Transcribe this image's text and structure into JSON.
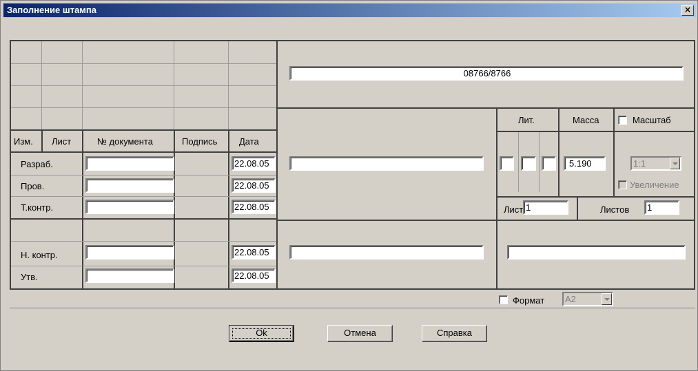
{
  "window": {
    "title": "Заполнение штампа",
    "close_label": "×"
  },
  "table": {
    "headers": {
      "izm": "Изм.",
      "list": "Лист",
      "doc": "№ документа",
      "sign": "Подпись",
      "date": "Дата"
    },
    "rows": {
      "razrab": {
        "label": "Разраб.",
        "doc": "",
        "date": "22.08.05"
      },
      "prov": {
        "label": "Пров.",
        "doc": "",
        "date": "22.08.05"
      },
      "tkontr": {
        "label": "Т.контр.",
        "doc": "",
        "date": "22.08.05"
      },
      "nkontr": {
        "label": "Н. контр.",
        "doc": "",
        "date": "22.08.05"
      },
      "utv": {
        "label": "Утв.",
        "doc": "",
        "date": "22.08.05"
      }
    }
  },
  "right": {
    "designation": "08766/8766",
    "name": "",
    "material": "",
    "organization": "",
    "lit_label": "Лит.",
    "lit": [
      "",
      "",
      ""
    ],
    "massa_label": "Масса",
    "massa": "5.190",
    "masshtab_label": "Масштаб",
    "masshtab_checked": false,
    "scale": "1:1",
    "uvelichenie_label": "Увеличение",
    "uvelichenie_checked": false,
    "sheet_label": "Лист",
    "sheet": "1",
    "sheets_label": "Листов",
    "sheets": "1"
  },
  "format": {
    "label": "Формат",
    "checked": false,
    "value": "A2"
  },
  "buttons": {
    "ok": "Ok",
    "cancel": "Отмена",
    "help": "Справка"
  }
}
